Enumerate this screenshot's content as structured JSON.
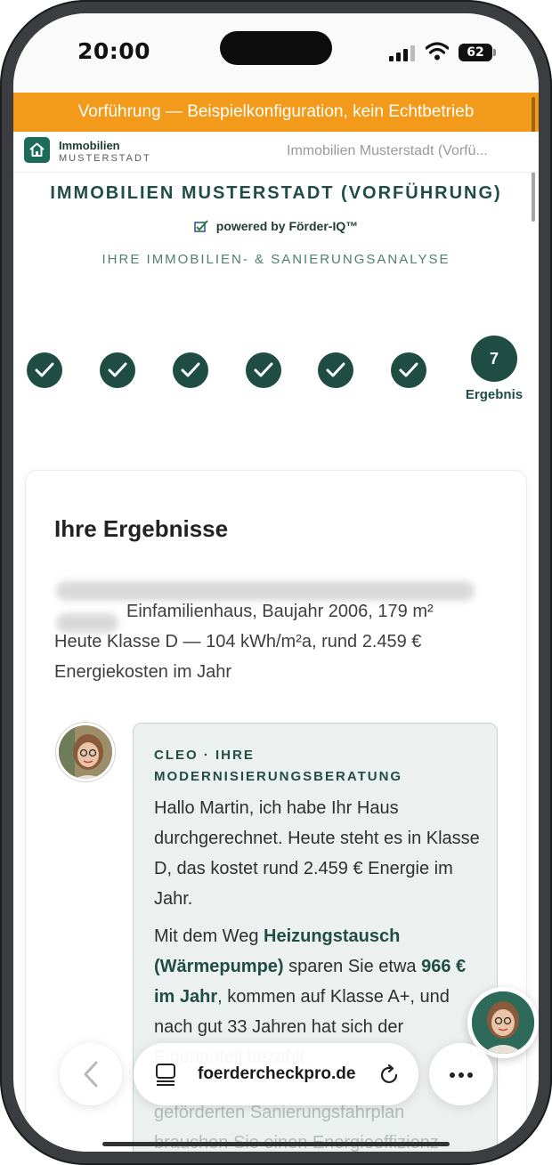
{
  "status_bar": {
    "time": "20:00",
    "battery": "62",
    "icons": [
      "cellular-signal-icon",
      "wifi-icon",
      "battery-icon"
    ]
  },
  "demo_banner": {
    "text": "Vorführung — Beispielkonfiguration, kein Echtbetrieb",
    "color": "#f49a1a"
  },
  "site_header": {
    "logo_name": "Immobilien",
    "logo_sub": "MUSTERSTADT",
    "page_title": "Immobilien Musterstadt (Vorfü..."
  },
  "brand": {
    "title": "IMMOBILIEN MUSTERSTADT (VORFÜHRUNG)",
    "powered_by": "powered by Förder-IQ™",
    "subtitle": "IHRE IMMOBILIEN- & SANIERUNGSANALYSE",
    "accent_color": "#1f4d44"
  },
  "stepper": {
    "completed_steps": 6,
    "current_step_number": "7",
    "current_step_label": "Ergebnis"
  },
  "results": {
    "title": "Ihre Ergebnisse",
    "summary_line1": "Einfamilienhaus, Baujahr 2006, 179 m²",
    "summary_line2": "Heute Klasse D — 104 kWh/m²a, rund 2.459 €",
    "summary_line3": "Energiekosten im Jahr"
  },
  "advisor": {
    "label": "CLEO · IHRE MODERNISIERUNGSBERATUNG",
    "message1": "Hallo Martin, ich habe Ihr Haus durchgerechnet. Heute steht es in Klasse D, das kostet rund 2.459 € Energie im Jahr.",
    "message2_part1": "Mit dem Weg ",
    "message2_bold1": "Heizungstausch (Wärmepumpe)",
    "message2_part2": " sparen Sie etwa ",
    "message2_bold2": "966 € im Jahr",
    "message2_part3": ", kommen auf Klasse A+, und nach gut 33 Jahren hat sich der Eigenanteil bezahlt.",
    "message3_faded": "geförderten Sanierungsfahrplan brauchen Sie einen Energieeffizienz-"
  },
  "browser_bar": {
    "url": "foerdercheckpro.de"
  }
}
